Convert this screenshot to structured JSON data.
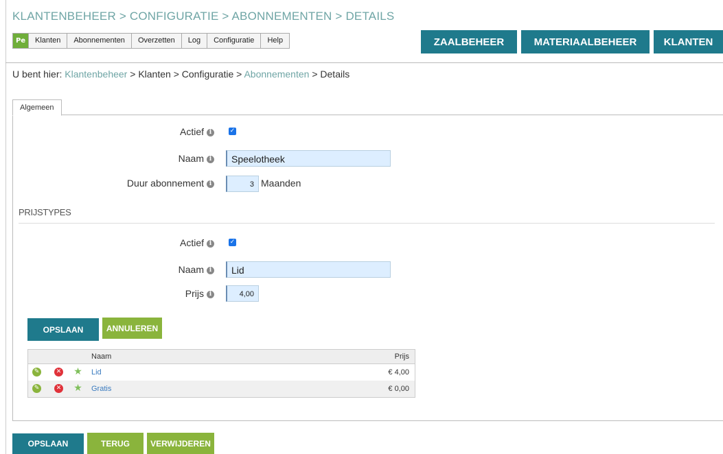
{
  "header": {
    "title": "KLANTENBEHEER > CONFIGURATIE > ABONNEMENTEN > DETAILS",
    "logo_text": "Pe",
    "menu": [
      "Klanten",
      "Abonnementen",
      "Overzetten",
      "Log",
      "Configuratie",
      "Help"
    ],
    "big_buttons": [
      "ZAALBEHEER",
      "MATERIAALBEHEER",
      "KLANTEN"
    ]
  },
  "breadcrumb": {
    "prefix": "U bent hier:",
    "items": [
      "Klantenbeheer",
      "Klanten",
      "Configuratie",
      "Abonnementen",
      "Details"
    ],
    "sep": ">"
  },
  "tab": {
    "label": "Algemeen"
  },
  "form": {
    "actief_label": "Actief",
    "actief_checked": true,
    "naam_label": "Naam",
    "naam_value": "Speelotheek",
    "duur_label": "Duur abonnement",
    "duur_value": "3",
    "duur_unit": "Maanden"
  },
  "prijstypes": {
    "title": "PRIJSTYPES",
    "actief_label": "Actief",
    "actief_checked": true,
    "naam_label": "Naam",
    "naam_value": "Lid",
    "prijs_label": "Prijs",
    "prijs_value": "4,00",
    "save_label": "OPSLAAN",
    "cancel_label": "ANNULEREN",
    "table": {
      "headers": [
        "Naam",
        "Prijs"
      ],
      "rows": [
        {
          "naam": "Lid",
          "prijs": "€ 4,00"
        },
        {
          "naam": "Gratis",
          "prijs": "€ 0,00"
        }
      ]
    }
  },
  "footer": {
    "save_label": "OPSLAAN",
    "back_label": "TERUG",
    "delete_label": "VERWIJDEREN"
  },
  "colors": {
    "teal": "#1f7a8c",
    "green": "#8ab43c",
    "title": "#6fa5a5",
    "input_bg": "#ddeeff"
  }
}
